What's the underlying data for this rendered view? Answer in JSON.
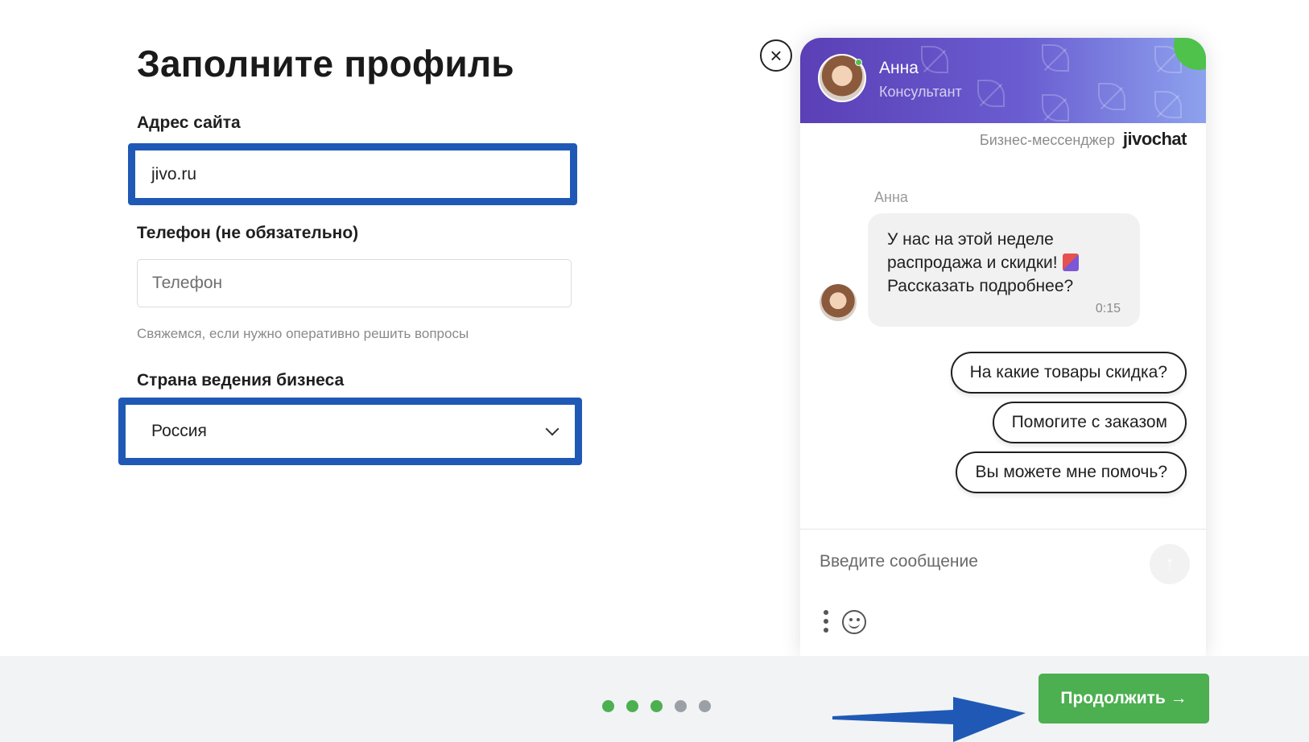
{
  "form": {
    "title": "Заполните профиль",
    "site": {
      "label": "Адрес сайта",
      "value": "jivo.ru"
    },
    "phone": {
      "label": "Телефон (не обязательно)",
      "placeholder": "Телефон",
      "hint": "Свяжемся, если нужно оперативно решить вопросы"
    },
    "country": {
      "label": "Страна ведения бизнеса",
      "value": "Россия"
    }
  },
  "chat": {
    "close_icon": "×",
    "agent_name": "Анна",
    "agent_role": "Консультант",
    "tagline": "Бизнес-мессенджер",
    "logo": "jivochat",
    "message": {
      "sender": "Анна",
      "lines": [
        "У нас на этой неделе",
        "распродажа и скидки!",
        "Рассказать подробнее?"
      ],
      "time": "0:15"
    },
    "quick_replies": [
      "На какие товары скидка?",
      "Помогите с заказом",
      "Вы можете мне помочь?"
    ],
    "input_placeholder": "Введите сообщение",
    "send_icon": "↑"
  },
  "footer": {
    "steps": {
      "total": 5,
      "completed": 3,
      "active_color": "#4caf50",
      "inactive_color": "#9aa0a6"
    },
    "continue_label": "Продолжить →"
  },
  "colors": {
    "highlight": "#1f59b5",
    "brand_green": "#4caf50",
    "header_purple": "#5b3fb6"
  }
}
